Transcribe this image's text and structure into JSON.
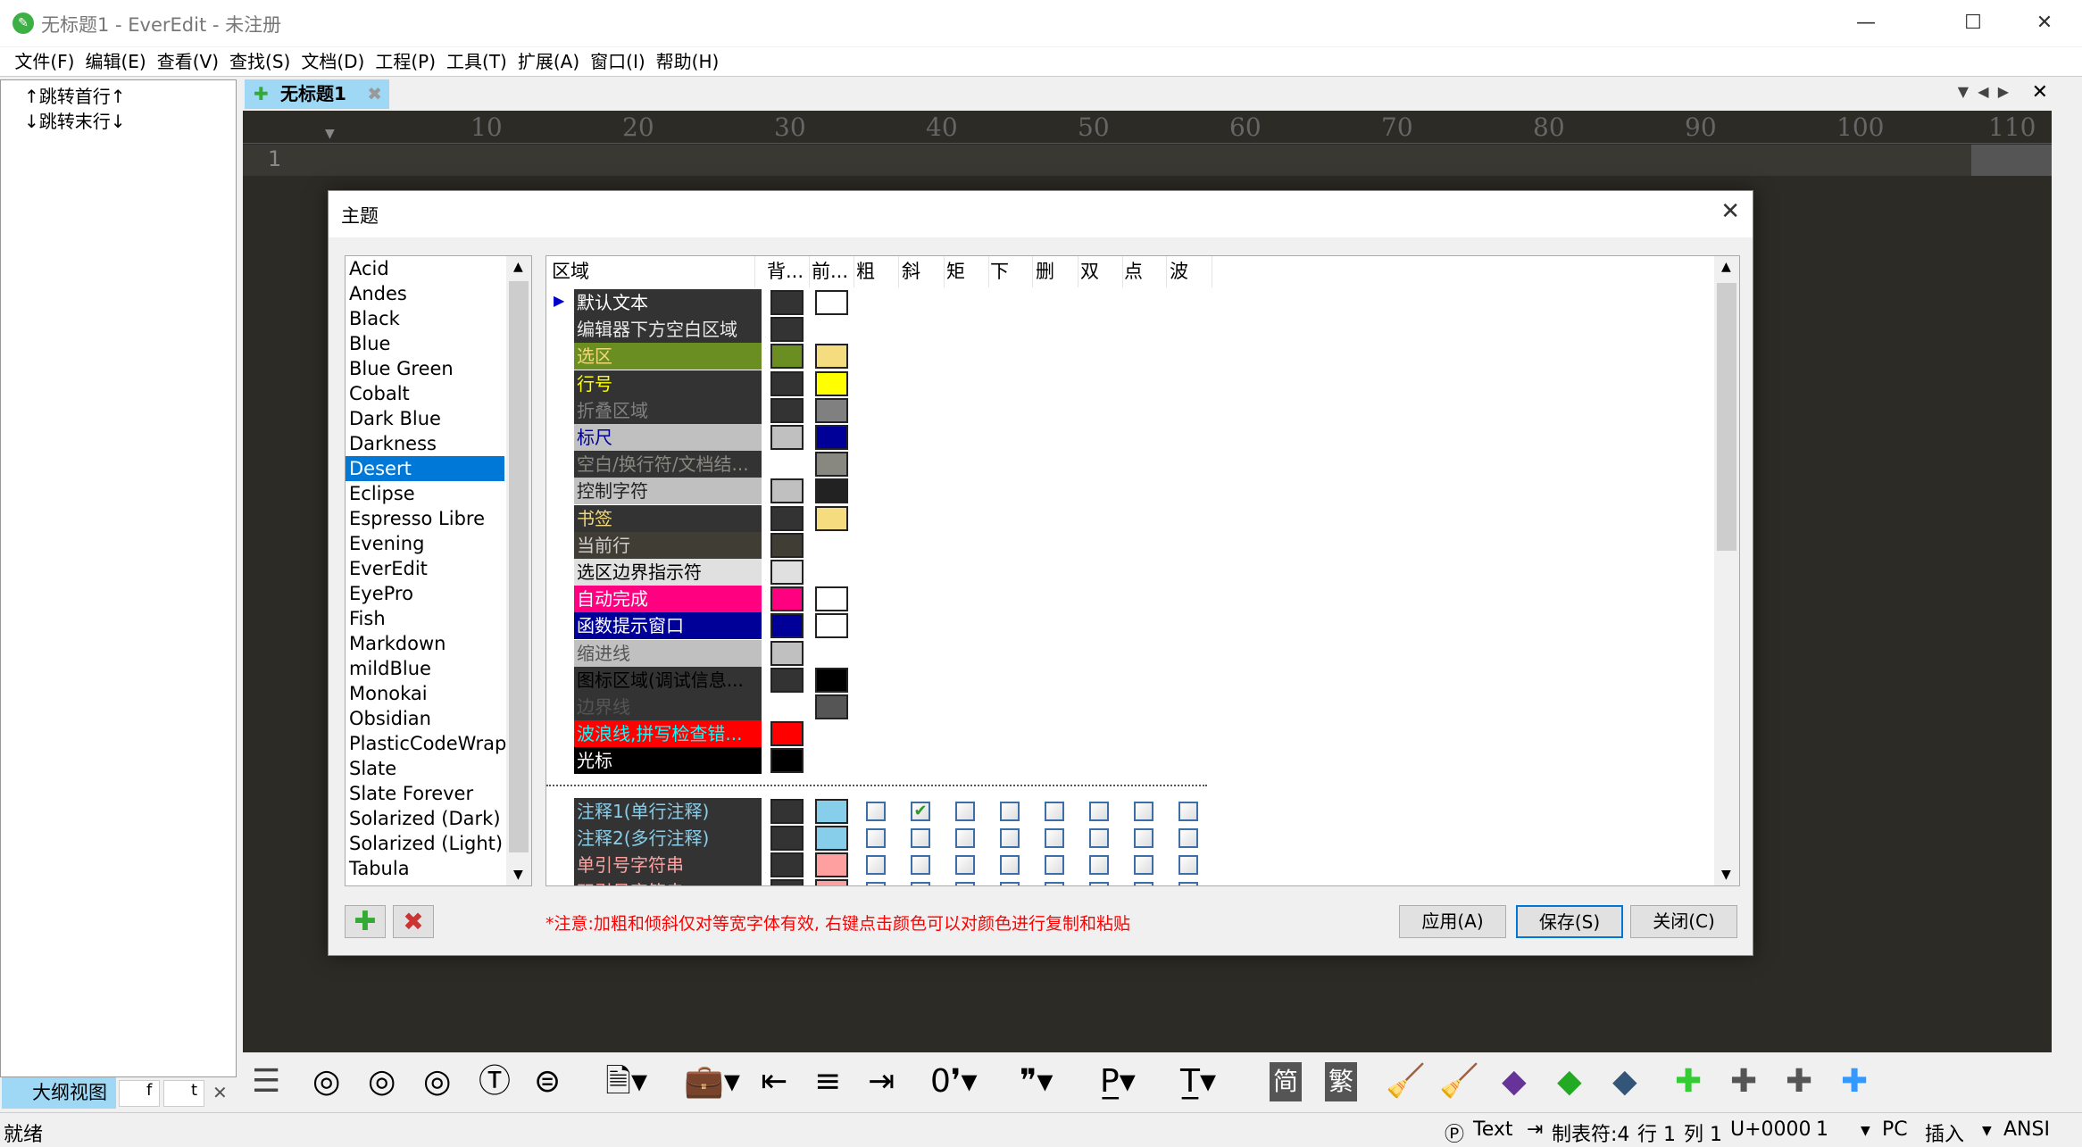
{
  "window": {
    "title": "无标题1 - EverEdit - 未注册",
    "icon": "evereedit-pencil-icon"
  },
  "menu": [
    "文件(F)",
    "编辑(E)",
    "查看(V)",
    "查找(S)",
    "文档(D)",
    "工程(P)",
    "工具(T)",
    "扩展(A)",
    "窗口(I)",
    "帮助(H)"
  ],
  "outline": {
    "items": [
      "↑跳转首行↑",
      "↓跳转末行↓"
    ],
    "tabs": [
      "大纲视图",
      "f",
      "t"
    ]
  },
  "doc_tab": {
    "label": "无标题1"
  },
  "ruler": [
    "10",
    "20",
    "30",
    "40",
    "50",
    "60",
    "70",
    "80",
    "90",
    "100",
    "110"
  ],
  "editor": {
    "line_number": "1"
  },
  "dialog": {
    "title": "主题",
    "themes": [
      "Acid",
      "Andes",
      "Black",
      "Blue",
      "Blue Green",
      "Cobalt",
      "Dark Blue",
      "Darkness",
      "Desert",
      "Eclipse",
      "Espresso Libre",
      "Evening",
      "EverEdit",
      "EyePro",
      "Fish",
      "Markdown",
      "mildBlue",
      "Monokai",
      "Obsidian",
      "PlasticCodeWrap",
      "Slate",
      "Slate Forever",
      "Solarized (Dark)",
      "Solarized (Light)",
      "Tabula"
    ],
    "selected_theme": "Desert",
    "columns": [
      "区域",
      "背...",
      "前...",
      "粗",
      "斜",
      "矩",
      "下",
      "删",
      "双",
      "点",
      "波"
    ],
    "rows": [
      {
        "name": "默认文本",
        "row_bg": "#333333",
        "text": "#ffffff",
        "bg": "#333333",
        "fg": "#ffffff"
      },
      {
        "name": "编辑器下方空白区域",
        "row_bg": "#333333",
        "text": "#e8e8e8",
        "bg": "#333333",
        "fg": null
      },
      {
        "name": "选区",
        "row_bg": "#6b8e23",
        "text": "#f0d878",
        "bg": "#6b8e23",
        "fg": "#f5dc7e"
      },
      {
        "name": "行号",
        "row_bg": "#333333",
        "text": "#ffff00",
        "bg": "#333333",
        "fg": "#ffff00"
      },
      {
        "name": "折叠区域",
        "row_bg": "#333333",
        "text": "#808080",
        "bg": "#333333",
        "fg": "#808080"
      },
      {
        "name": "标尺",
        "row_bg": "#c0c0c0",
        "text": "#000099",
        "bg": "#c0c0c0",
        "fg": "#000099"
      },
      {
        "name": "空白/换行符/文档结...",
        "row_bg": "#333333",
        "text": "#888880",
        "bg": null,
        "fg": "#888880"
      },
      {
        "name": "控制字符",
        "row_bg": "#c0c0c0",
        "text": "#222222",
        "bg": "#c0c0c0",
        "fg": "#222222"
      },
      {
        "name": "书签",
        "row_bg": "#333333",
        "text": "#f0d878",
        "bg": "#333333",
        "fg": "#f5dc7e"
      },
      {
        "name": "当前行",
        "row_bg": "#403d35",
        "text": "#cccccc",
        "bg": "#403d35",
        "fg": null
      },
      {
        "name": "选区边界指示符",
        "row_bg": "#e0e0e0",
        "text": "#000000",
        "bg": "#e0e0e0",
        "fg": null
      },
      {
        "name": "自动完成",
        "row_bg": "#ff0080",
        "text": "#ffffff",
        "bg": "#ff0080",
        "fg": "#ffffff"
      },
      {
        "name": "函数提示窗口",
        "row_bg": "#000099",
        "text": "#ffffff",
        "bg": "#000099",
        "fg": "#ffffff"
      },
      {
        "name": "缩进线",
        "row_bg": "#c0c0c0",
        "text": "#555555",
        "bg": "#c0c0c0",
        "fg": null
      },
      {
        "name": "图标区域(调试信息...",
        "row_bg": "#333333",
        "text": "#000000",
        "bg": "#333333",
        "fg": "#000000"
      },
      {
        "name": "边界线",
        "row_bg": "#333333",
        "text": "#555555",
        "bg": null,
        "fg": "#555555"
      },
      {
        "name": "波浪线,拼写检查错...",
        "row_bg": "#ff0000",
        "text": "#00ffff",
        "bg": "#ff0000",
        "fg": null
      },
      {
        "name": "光标",
        "row_bg": "#000000",
        "text": "#ffffff",
        "bg": "#000000",
        "fg": null
      }
    ],
    "style_rows": [
      {
        "name": "注释1(单行注释)",
        "row_bg": "#333333",
        "text": "#87ceeb",
        "bg": "#333333",
        "fg": "#87ceeb",
        "flags": [
          false,
          true,
          false,
          false,
          false,
          false,
          false,
          false
        ]
      },
      {
        "name": "注释2(多行注释)",
        "row_bg": "#333333",
        "text": "#87ceeb",
        "bg": "#333333",
        "fg": "#87ceeb",
        "flags": [
          false,
          false,
          false,
          false,
          false,
          false,
          false,
          false
        ]
      },
      {
        "name": "单引号字符串",
        "row_bg": "#333333",
        "text": "#ffa0a0",
        "bg": "#333333",
        "fg": "#ffa0a0",
        "flags": [
          false,
          false,
          false,
          false,
          false,
          false,
          false,
          false
        ]
      },
      {
        "name": "双引号字符串",
        "row_bg": "#333333",
        "text": "#ffa0a0",
        "bg": "#333333",
        "fg": "#ffa0a0",
        "flags": [
          false,
          false,
          false,
          false,
          false,
          false,
          false,
          false
        ]
      }
    ],
    "note": "*注意:加粗和倾斜仅对等宽字体有效, 右键点击颜色可以对颜色进行复制和粘贴",
    "apply": "应用(A)",
    "save": "保存(S)",
    "close": "关闭(C)"
  },
  "status": {
    "ready": "就绪",
    "syntax": "Text",
    "tab": "制表符:4",
    "line": "行 1",
    "col": "列 1",
    "unicode": "U+0000",
    "sel": "1",
    "eol": "PC",
    "mode": "插入",
    "encoding": "ANSI"
  }
}
